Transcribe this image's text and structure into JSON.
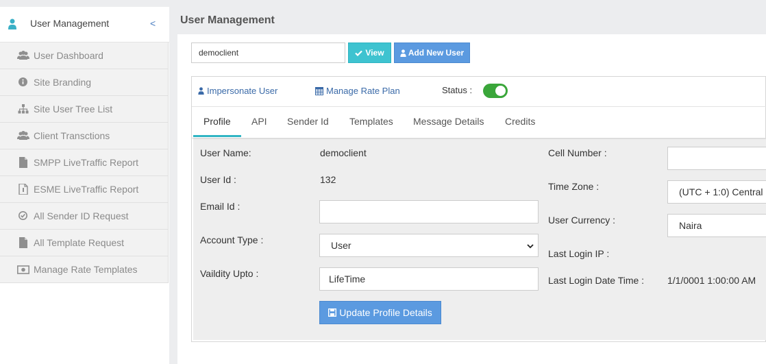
{
  "sidebar": {
    "header_label": "User Management",
    "collapse_glyph": "<",
    "items": [
      {
        "label": "User Dashboard",
        "icon": "users-icon"
      },
      {
        "label": "Site Branding",
        "icon": "info-icon"
      },
      {
        "label": "Site User Tree List",
        "icon": "sitemap-icon"
      },
      {
        "label": "Client Transctions",
        "icon": "users-icon"
      },
      {
        "label": "SMPP LiveTraffic Report",
        "icon": "file-icon"
      },
      {
        "label": "ESME LiveTraffic Report",
        "icon": "file-icon"
      },
      {
        "label": "All Sender ID Request",
        "icon": "check-circle-icon"
      },
      {
        "label": "All Template Request",
        "icon": "file-icon"
      },
      {
        "label": "Manage Rate Templates",
        "icon": "money-icon"
      }
    ]
  },
  "page": {
    "title": "User Management"
  },
  "toolbar": {
    "client_value": "democlient",
    "view_label": "View",
    "add_user_label": "Add New User"
  },
  "actions": {
    "impersonate_label": "Impersonate User",
    "rate_plan_label": "Manage Rate Plan",
    "status_label": "Status :",
    "status_on": true
  },
  "tabs": [
    "Profile",
    "API",
    "Sender Id",
    "Templates",
    "Message Details",
    "Credits"
  ],
  "profile": {
    "username_label": "User Name:",
    "username_value": "democlient",
    "userid_label": "User Id :",
    "userid_value": "132",
    "email_label": "Email Id :",
    "email_value": "",
    "account_type_label": "Account Type :",
    "account_type_value": "User",
    "validity_label": "Vaildity Upto :",
    "validity_value": "LifeTime",
    "update_label": "Update Profile Details",
    "cell_label": "Cell Number :",
    "cell_value": "",
    "timezone_label": "Time Zone :",
    "timezone_value": "(UTC + 1:0) Central",
    "currency_label": "User Currency :",
    "currency_value": "Naira",
    "last_ip_label": "Last Login IP :",
    "last_ip_value": "",
    "last_login_label": "Last Login Date Time :",
    "last_login_value": "1/1/0001 1:00:00 AM"
  },
  "colors": {
    "view_button": "#3ec3d0",
    "primary_button": "#5b9ae0",
    "toggle_on": "#3aa63a",
    "link": "#3a6aa8",
    "tab_underline": "#31b5c4"
  }
}
